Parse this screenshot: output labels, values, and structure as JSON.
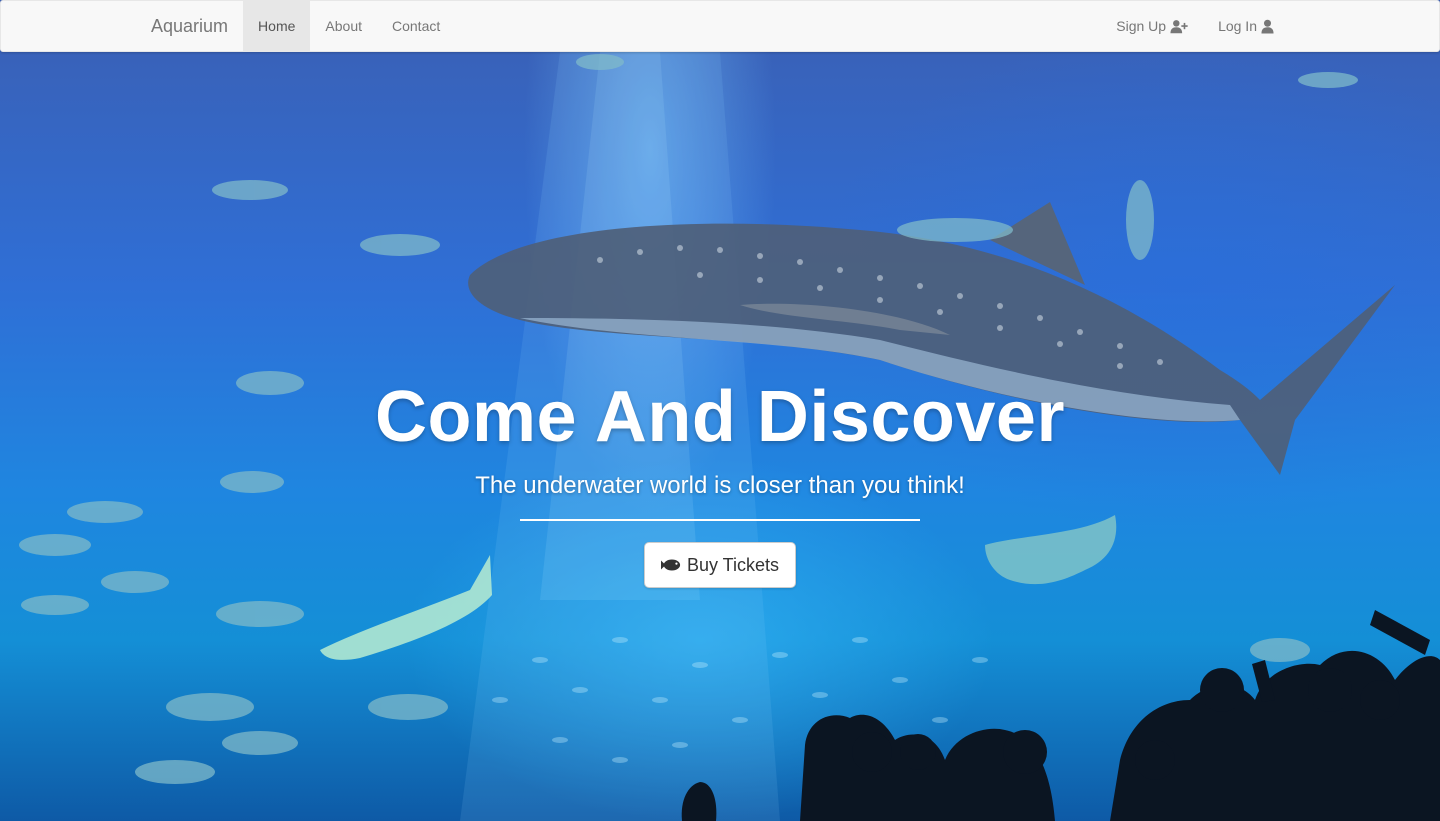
{
  "navbar": {
    "brand": "Aquarium",
    "items": [
      {
        "label": "Home",
        "active": true
      },
      {
        "label": "About",
        "active": false
      },
      {
        "label": "Contact",
        "active": false
      }
    ],
    "right_items": [
      {
        "label": "Sign Up",
        "icon": "user-plus-icon"
      },
      {
        "label": "Log In",
        "icon": "user-icon"
      }
    ]
  },
  "hero": {
    "title": "Come And Discover",
    "subtitle": "The underwater world is closer than you think!",
    "cta": {
      "label": "Buy Tickets",
      "icon": "fish-icon"
    }
  },
  "colors": {
    "navbar_bg": "#f8f8f8",
    "active_tab_bg": "#e7e7e7",
    "nav_text": "#777777",
    "hero_text": "#ffffff",
    "water_deep": "#2f6fd6",
    "water_light": "#148fd6"
  }
}
